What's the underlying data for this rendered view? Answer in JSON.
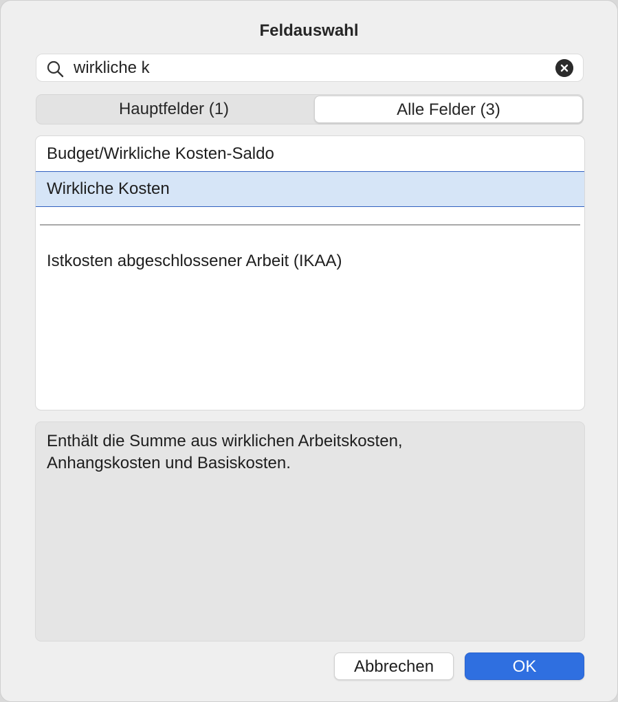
{
  "dialog": {
    "title": "Feldauswahl"
  },
  "search": {
    "value": "wirkliche k",
    "icon": "search-icon",
    "clear_icon": "clear-icon"
  },
  "tabs": {
    "main_fields": "Hauptfelder (1)",
    "all_fields": "Alle Felder (3)",
    "selected": "all_fields"
  },
  "fields": {
    "items": [
      "Budget/Wirkliche Kosten-Saldo",
      "Wirkliche Kosten",
      "Istkosten abgeschlossener Arbeit (IKAA)"
    ],
    "selected_index": 1
  },
  "description": {
    "line1": "Enthält die Summe aus wirklichen Arbeitskosten,",
    "line2": "Anhangskosten und Basiskosten."
  },
  "buttons": {
    "cancel": "Abbrechen",
    "ok": "OK"
  },
  "colors": {
    "accent": "#2f6fe0",
    "selection": "#d6e5f7"
  }
}
